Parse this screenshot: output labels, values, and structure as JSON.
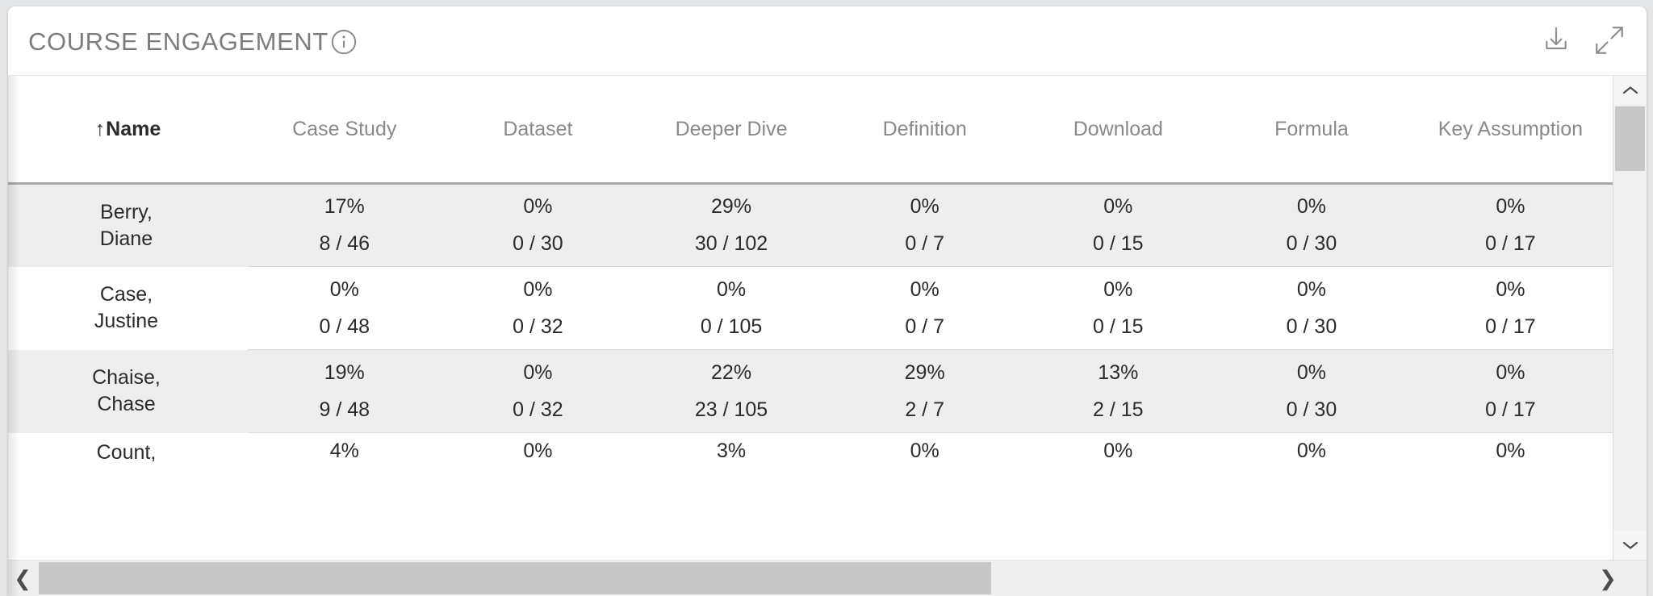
{
  "card": {
    "title": "COURSE ENGAGEMENT",
    "info_icon": "info-icon",
    "actions": [
      {
        "name": "download-icon",
        "label": "Download"
      },
      {
        "name": "expand-icon",
        "label": "Expand"
      }
    ]
  },
  "table": {
    "sort": {
      "column": "Name",
      "direction": "ascending",
      "arrow": "↑"
    },
    "columns": [
      "Name",
      "Case Study",
      "Dataset",
      "Deeper Dive",
      "Definition",
      "Download",
      "Formula",
      "Key Assumption"
    ],
    "rows": [
      {
        "name_lines": [
          "Berry,",
          "Diane"
        ],
        "percents": [
          "17%",
          "0%",
          "29%",
          "0%",
          "0%",
          "0%",
          "0%"
        ],
        "fractions": [
          "8 / 46",
          "0 / 30",
          "30 / 102",
          "0 / 7",
          "0 / 15",
          "0 / 30",
          "0 / 17"
        ]
      },
      {
        "name_lines": [
          "Case,",
          "Justine"
        ],
        "percents": [
          "0%",
          "0%",
          "0%",
          "0%",
          "0%",
          "0%",
          "0%"
        ],
        "fractions": [
          "0 / 48",
          "0 / 32",
          "0 / 105",
          "0 / 7",
          "0 / 15",
          "0 / 30",
          "0 / 17"
        ]
      },
      {
        "name_lines": [
          "Chaise,",
          "Chase"
        ],
        "percents": [
          "19%",
          "0%",
          "22%",
          "29%",
          "13%",
          "0%",
          "0%"
        ],
        "fractions": [
          "9 / 48",
          "0 / 32",
          "23 / 105",
          "2 / 7",
          "2 / 15",
          "0 / 30",
          "0 / 17"
        ]
      },
      {
        "name_lines": [
          "Count,"
        ],
        "percents": [
          "4%",
          "0%",
          "3%",
          "0%",
          "0%",
          "0%",
          "0%"
        ],
        "fractions": [
          "",
          "",
          "",
          "",
          "",
          "",
          ""
        ]
      }
    ]
  },
  "scrollbars": {
    "vertical": {
      "up_arrow": "⌃",
      "down_arrow": "⌄"
    },
    "horizontal": {
      "left_arrow": "❮",
      "right_arrow": "❯"
    }
  },
  "colors": {
    "page_background": "#e3e5e7",
    "card_background": "#ffffff",
    "row_shaded": "#eeeeee",
    "title_text": "#7d7d7d",
    "header_text": "#8a8a8a",
    "body_text": "#2b2b2b",
    "header_rule": "#a8a8a8",
    "scroll_thumb": "#c7c7c7"
  }
}
